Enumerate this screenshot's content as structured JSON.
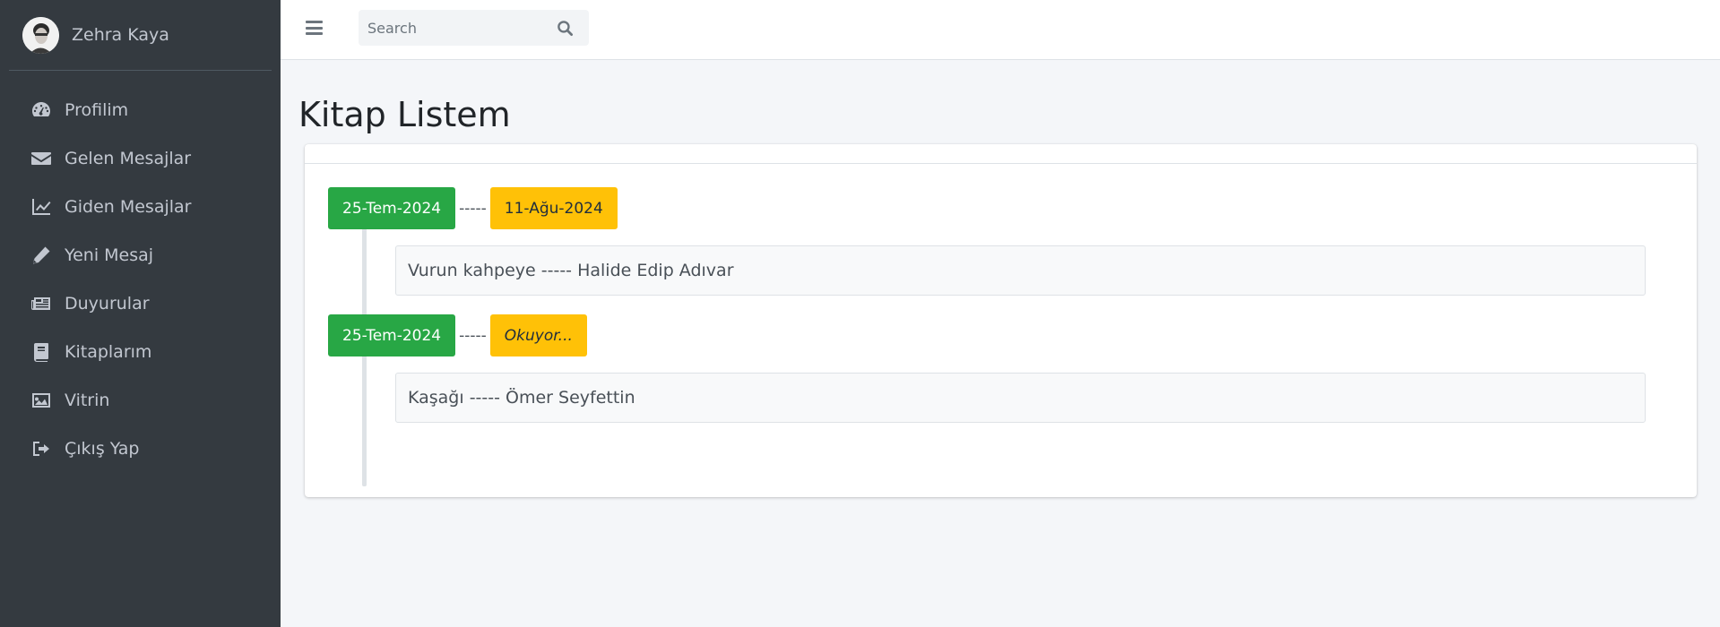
{
  "user": {
    "name": "Zehra Kaya"
  },
  "sidebar": {
    "items": [
      {
        "label": "Profilim",
        "icon": "dashboard-icon"
      },
      {
        "label": "Gelen Mesajlar",
        "icon": "envelope-icon"
      },
      {
        "label": "Giden Mesajlar",
        "icon": "chart-icon"
      },
      {
        "label": "Yeni Mesaj",
        "icon": "pencil-icon"
      },
      {
        "label": "Duyurular",
        "icon": "newspaper-icon"
      },
      {
        "label": "Kitaplarım",
        "icon": "book-icon"
      },
      {
        "label": "Vitrin",
        "icon": "image-icon"
      },
      {
        "label": "Çıkış Yap",
        "icon": "sign-out-icon"
      }
    ]
  },
  "topbar": {
    "search_placeholder": "Search"
  },
  "page": {
    "title": "Kitap Listem"
  },
  "timeline": {
    "separator": "-----",
    "entries": [
      {
        "start": "25-Tem-2024",
        "end": "11-Ağu-2024",
        "book": "Vurun kahpeye ----- Halide Edip Adıvar"
      },
      {
        "start": "25-Tem-2024",
        "end": "Okuyor...",
        "book": "Kaşağı ----- Ömer Seyfettin"
      }
    ]
  },
  "colors": {
    "sidebar": "#343a40",
    "success": "#28a745",
    "warning": "#ffc107"
  }
}
